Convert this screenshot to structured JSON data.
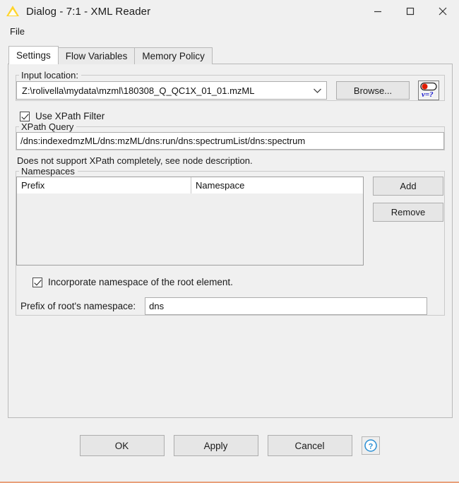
{
  "window": {
    "title": "Dialog - 7:1 - XML Reader",
    "icon": "warning-triangle-icon",
    "controls": {
      "minimize": "minimize-icon",
      "maximize": "maximize-icon",
      "close": "close-icon"
    }
  },
  "menubar": {
    "items": [
      {
        "label": "File"
      }
    ]
  },
  "tabs": [
    {
      "label": "Settings",
      "active": true
    },
    {
      "label": "Flow Variables",
      "active": false
    },
    {
      "label": "Memory Policy",
      "active": false
    }
  ],
  "settings": {
    "input_location": {
      "legend": "Input location:",
      "path_value": "Z:\\rolivella\\mydata\\mzml\\180308_Q_QC1X_01_01.mzML",
      "path_placeholder": "",
      "browse_label": "Browse...",
      "flow_variable_icon": "flow-variable-icon"
    },
    "use_xpath_filter": {
      "label": "Use XPath Filter",
      "checked": true
    },
    "xpath_query": {
      "legend": "XPath Query",
      "value": "/dns:indexedmzML/dns:mzML/dns:run/dns:spectrumList/dns:spectrum",
      "placeholder": "",
      "hint": "Does not support XPath completely, see node description."
    },
    "namespaces": {
      "legend": "Namespaces",
      "columns": [
        "Prefix",
        "Namespace"
      ],
      "rows": [],
      "add_label": "Add",
      "remove_label": "Remove"
    },
    "incorporate_root_namespace": {
      "label": "Incorporate namespace of the root element.",
      "checked": true
    },
    "root_prefix": {
      "label": "Prefix of root's namespace:",
      "value": "dns",
      "placeholder": ""
    }
  },
  "footer": {
    "ok_label": "OK",
    "apply_label": "Apply",
    "cancel_label": "Cancel",
    "help_icon": "help-circle-icon"
  },
  "colors": {
    "accent_bottom_border": "#e8a07a",
    "window_background": "#f0f0f0",
    "field_background": "#ffffff",
    "help_blue": "#2a8fd4",
    "warning_yellow": "#ffd42a"
  }
}
